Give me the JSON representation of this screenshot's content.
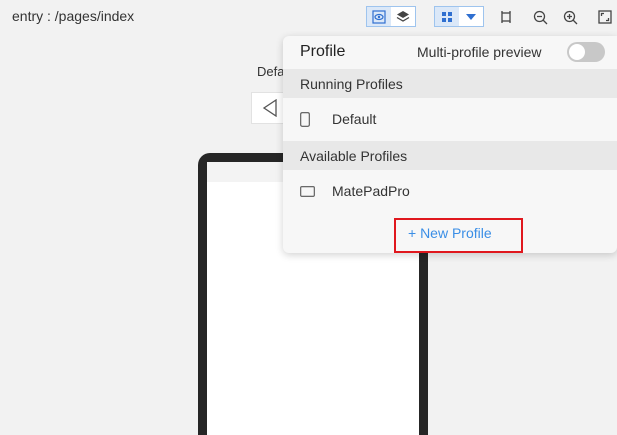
{
  "toolbar": {
    "path": "entry : /pages/index",
    "icons": [
      "eye-preview-icon",
      "layers-icon",
      "grid-icon",
      "dropdown-arrow-icon",
      "crop-frame-icon",
      "zoom-out-icon",
      "zoom-in-icon",
      "fit-screen-icon"
    ]
  },
  "preview": {
    "device_label": "Defa"
  },
  "popup": {
    "title": "Profile",
    "multi_profile_label": "Multi-profile preview",
    "multi_profile_enabled": false,
    "running_header": "Running Profiles",
    "running_profiles": [
      {
        "name": "Default",
        "icon": "phone-icon"
      }
    ],
    "available_header": "Available Profiles",
    "available_profiles": [
      {
        "name": "MatePadPro",
        "icon": "tablet-icon"
      }
    ],
    "new_profile_label": "+ New Profile"
  },
  "colors": {
    "accent": "#3a8ee6",
    "highlight_box": "#e0181e",
    "background": "#f2f2f2"
  }
}
